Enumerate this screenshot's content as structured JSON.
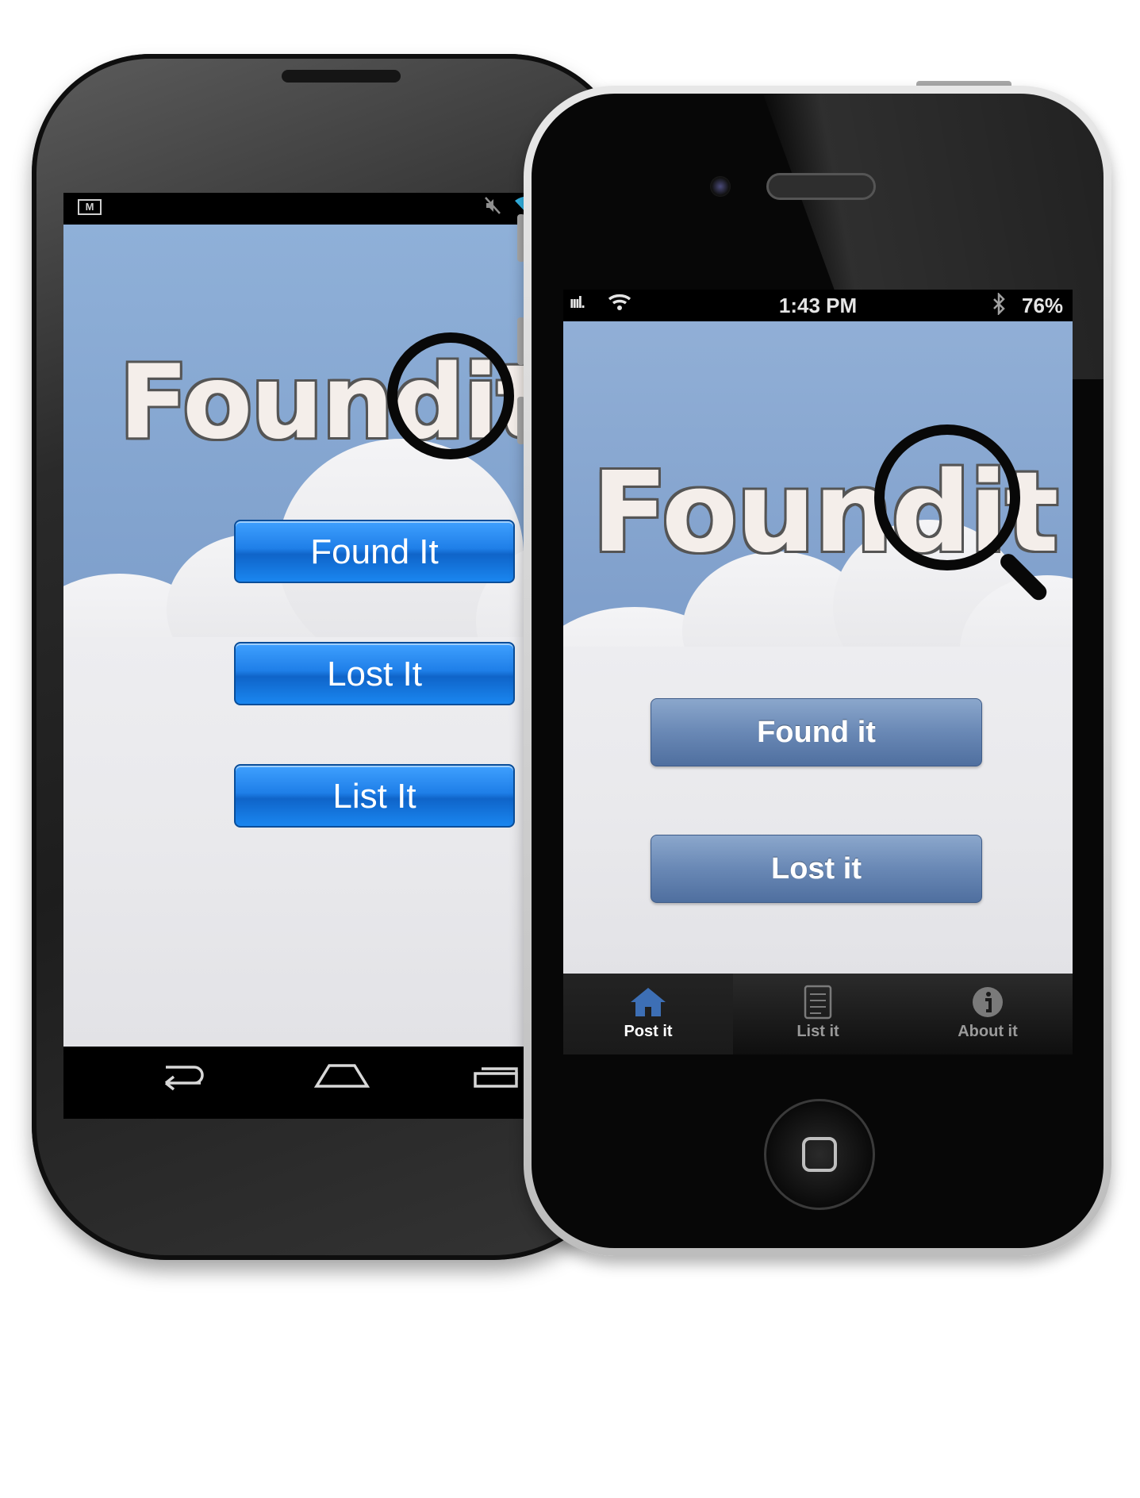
{
  "android": {
    "status": {
      "mail_icon": "M"
    },
    "logo": {
      "word": "Found",
      "it": "it"
    },
    "buttons": {
      "found": "Found It",
      "lost": "Lost It",
      "list": "List It"
    },
    "nav": {
      "back": "↩",
      "home": "⌂",
      "recent": "▭"
    }
  },
  "iphone": {
    "status": {
      "signal": "ıııl.",
      "wifi": "◠",
      "time": "1:43 PM",
      "bluetooth": "✱",
      "battery": "76%"
    },
    "logo": {
      "word": "Found",
      "it": "it"
    },
    "buttons": {
      "found": "Found it",
      "lost": "Lost it"
    },
    "tabs": [
      {
        "label": "Post it",
        "icon": "house-icon",
        "active": true
      },
      {
        "label": "List it",
        "icon": "list-icon",
        "active": false
      },
      {
        "label": "About it",
        "icon": "info-icon",
        "active": false
      }
    ]
  },
  "colors": {
    "sky": "#8fb0d8",
    "android_button": "#1f7fe8",
    "ios_button": "#6988b5",
    "tab_active": "#3d6fb5"
  }
}
